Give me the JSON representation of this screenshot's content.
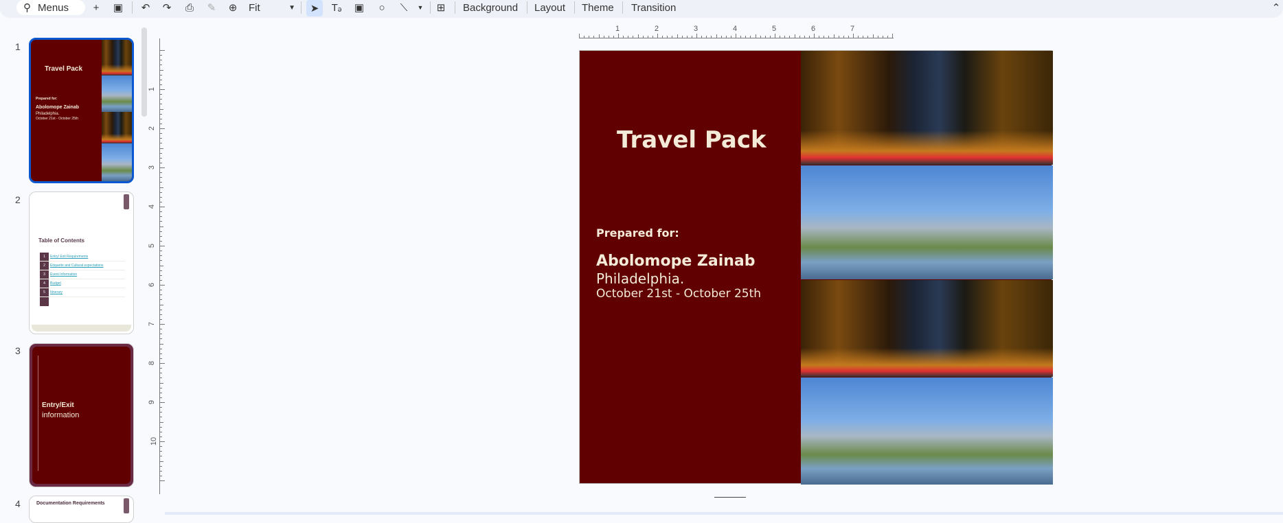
{
  "toolbar": {
    "search_label": "Menus",
    "zoom_value": "Fit",
    "buttons": {
      "background": "Background",
      "layout": "Layout",
      "theme": "Theme",
      "transition": "Transition"
    }
  },
  "sidebar": {
    "slides": [
      {
        "number": "1",
        "title": "Travel Pack",
        "prepared_for": "Prepared for:",
        "name": "Abolomope Zainab",
        "city": "Philadelphia.",
        "dates": "October 21st - October 25th"
      },
      {
        "number": "2",
        "title": "Table of Contents",
        "items": [
          {
            "num": "1",
            "label": "Entry/ Exit Requirements"
          },
          {
            "num": "2",
            "label": "Etiquette and Cultural expectations"
          },
          {
            "num": "3",
            "label": "Event Information"
          },
          {
            "num": "4",
            "label": "Budget"
          },
          {
            "num": "5",
            "label": "Itinerary"
          }
        ]
      },
      {
        "number": "3",
        "title_bold": "Entry/Exit",
        "title_light": "information"
      },
      {
        "number": "4",
        "title": "Documentation Requirements"
      }
    ]
  },
  "ruler": {
    "h_ticks": [
      "1",
      "2",
      "3",
      "4",
      "5",
      "6",
      "7"
    ],
    "v_ticks": [
      "1",
      "2",
      "3",
      "4",
      "5",
      "6",
      "7",
      "8",
      "9",
      "10"
    ]
  },
  "slide": {
    "title": "Travel Pack",
    "prepared_for": "Prepared for:",
    "name": "Abolomope Zainab",
    "city": "Philadelphia.",
    "dates": "October 21st - October 25th"
  },
  "colors": {
    "slide_bg": "#600000",
    "text": "#f3ead8",
    "selection": "#0b57d0"
  }
}
